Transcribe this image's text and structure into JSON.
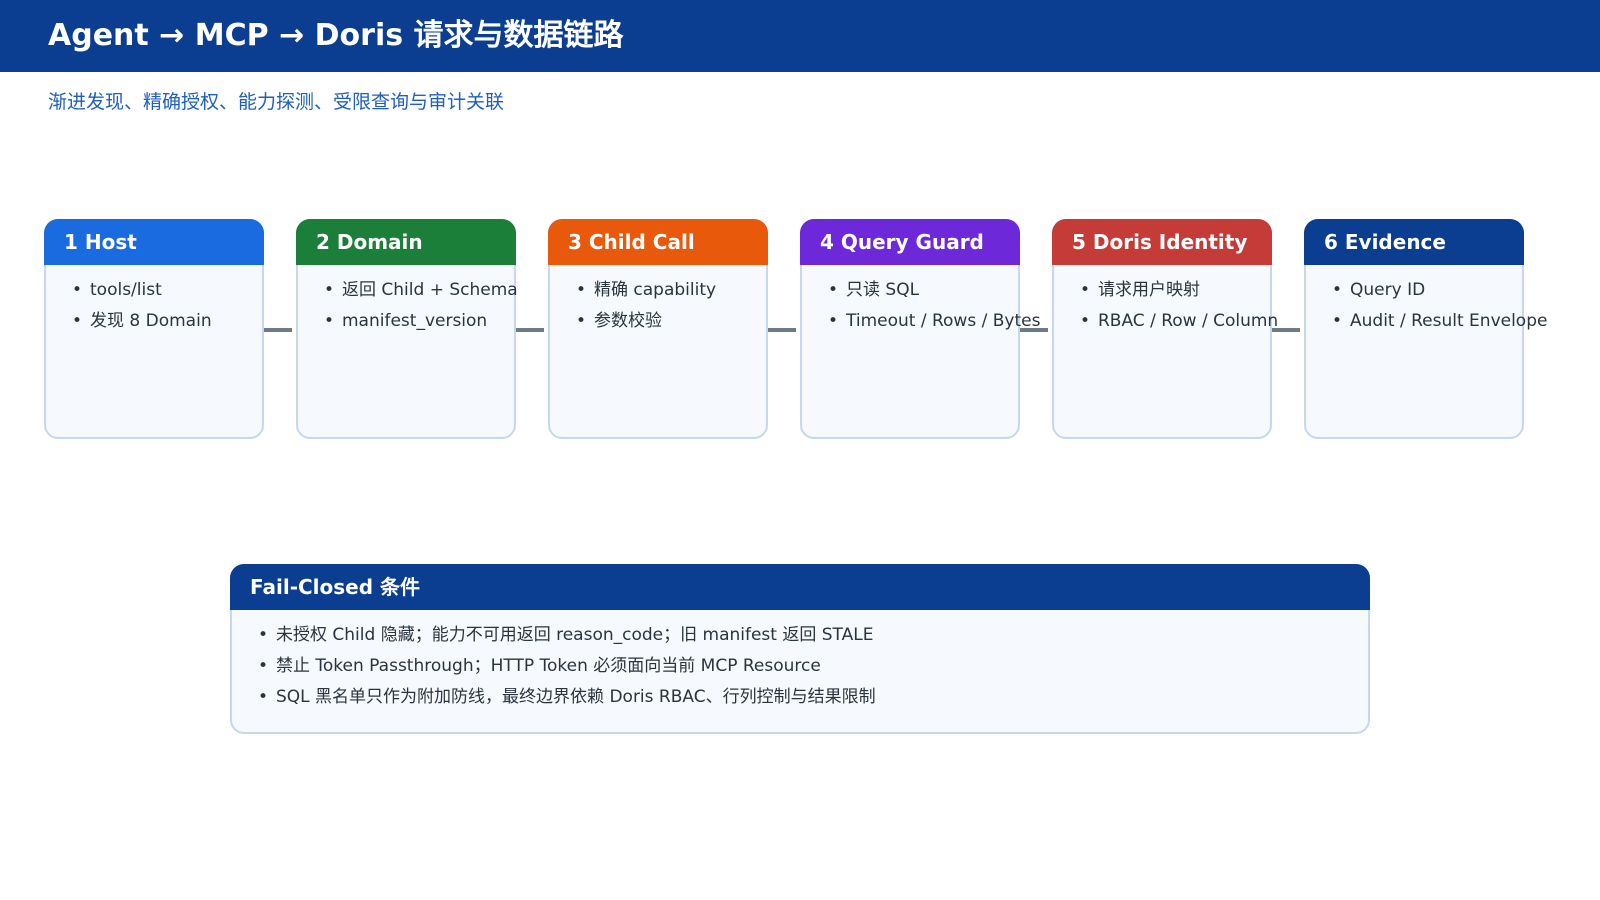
{
  "header": {
    "title": "Agent → MCP → Doris 请求与数据链路"
  },
  "subtitle": "渐进发现、精确授权、能力探测、受限查询与审计关联",
  "stages": [
    {
      "title": "1 Host",
      "color": "#1a6ae0",
      "items": [
        "tools/list",
        "发现 8 Domain"
      ]
    },
    {
      "title": "2 Domain",
      "color": "#1b7f3a",
      "items": [
        "返回 Child + Schema",
        "manifest_version"
      ]
    },
    {
      "title": "3 Child Call",
      "color": "#e8590c",
      "items": [
        "精确 capability",
        "参数校验"
      ]
    },
    {
      "title": "4 Query Guard",
      "color": "#6d28d9",
      "items": [
        "只读 SQL",
        "Timeout / Rows / Bytes"
      ]
    },
    {
      "title": "5 Doris Identity",
      "color": "#c53b37",
      "items": [
        "请求用户映射",
        "RBAC / Row / Column"
      ]
    },
    {
      "title": "6 Evidence",
      "color": "#0b3d91",
      "items": [
        "Query ID",
        "Audit / Result Envelope"
      ]
    }
  ],
  "fail_closed": {
    "title": "Fail-Closed 条件",
    "items": [
      "未授权 Child 隐藏；能力不可用返回 reason_code；旧 manifest 返回 STALE",
      "禁止 Token Passthrough；HTTP Token 必须面向当前 MCP Resource",
      "SQL 黑名单只作为附加防线，最终边界依赖 Doris RBAC、行列控制与结果限制"
    ]
  }
}
